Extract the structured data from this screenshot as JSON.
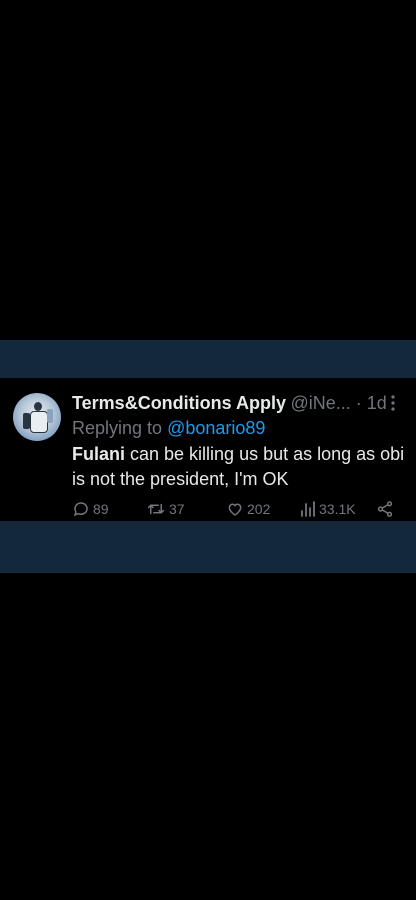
{
  "tweet": {
    "display_name": "Terms&Conditions Apply",
    "handle_time": "@iNe... · 1d",
    "more_icon": "more-vertical-icon",
    "replying_prefix": "Replying to",
    "replying_to": "@bonario89",
    "text_bold": "Fulani",
    "text_rest": " can be killing us but as long as obi is not the president, I'm OK",
    "actions": {
      "replies": "89",
      "retweets": "37",
      "likes": "202",
      "views": "33.1K"
    }
  },
  "colors": {
    "background": "#000000",
    "band": "#13283b",
    "muted": "#71767b",
    "link": "#1d9bf0",
    "text": "#e7e9ea"
  }
}
